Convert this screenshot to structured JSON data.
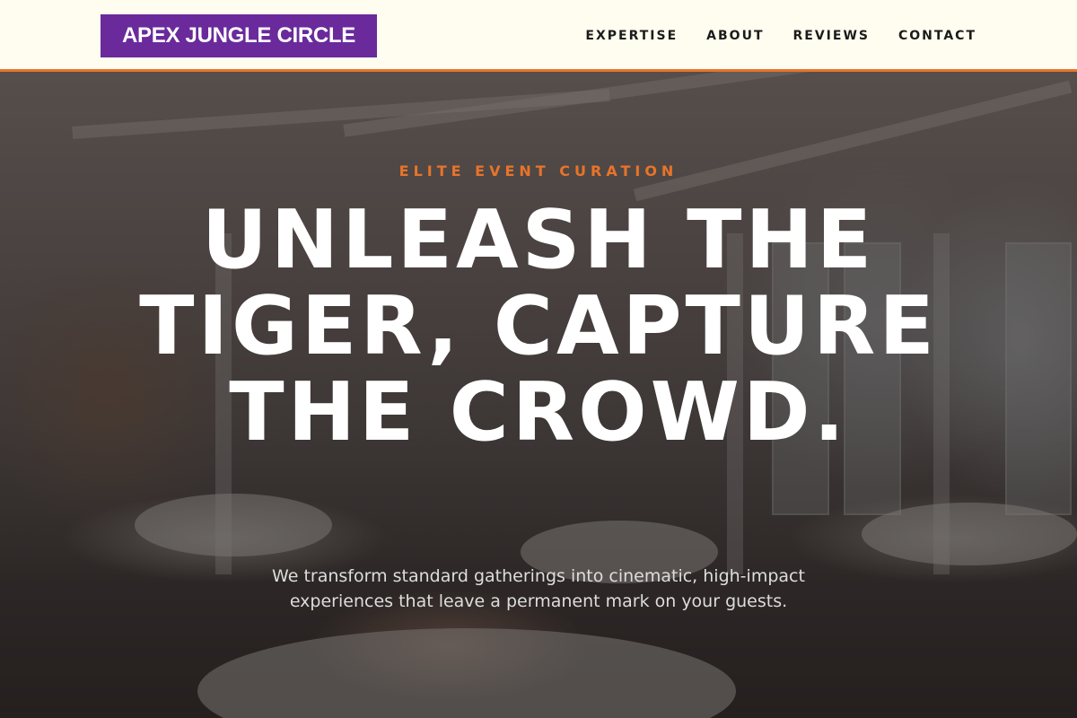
{
  "brand": {
    "name": "APEX JUNGLE CIRCLE",
    "logo_color": "#6a2a9b",
    "accent_color": "#e8742a",
    "header_bg": "#fffdf0"
  },
  "nav": {
    "items": [
      {
        "label": "EXPERTISE"
      },
      {
        "label": "ABOUT"
      },
      {
        "label": "REVIEWS"
      },
      {
        "label": "CONTACT"
      }
    ]
  },
  "hero": {
    "eyebrow": "ELITE EVENT CURATION",
    "headline": "UNLEASH THE TIGER, CAPTURE THE CROWD.",
    "subtext": "We transform standard gatherings into cinematic, high-impact experiences that leave a permanent mark on your guests.",
    "background_description_icon": "banquet-hall-photo"
  }
}
